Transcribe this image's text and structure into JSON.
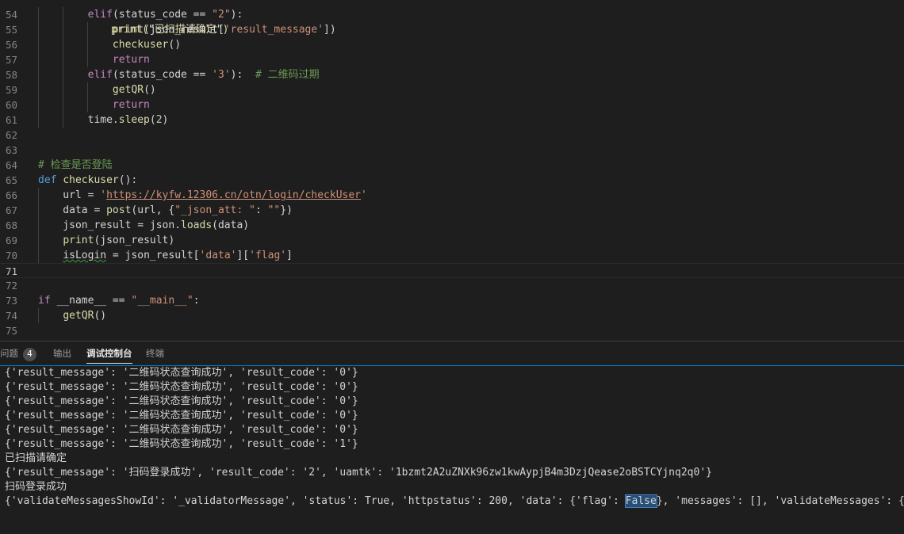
{
  "editor": {
    "lines": [
      {
        "num": "54",
        "segs": [
          {
            "t": "        "
          },
          {
            "t": "elif",
            "c": "kw"
          },
          {
            "t": "(status_code == "
          },
          {
            "t": "\"2\"",
            "c": "str"
          },
          {
            "t": "):"
          }
        ]
      },
      {
        "num": "55",
        "segs": [
          {
            "t": "            "
          },
          {
            "t": "print",
            "c": "fn"
          },
          {
            "t": "(json_result["
          },
          {
            "t": "'result_message'",
            "c": "str"
          },
          {
            "t": "])"
          }
        ]
      },
      {
        "num": "56",
        "segs": [
          {
            "t": "            "
          },
          {
            "t": "checkuser",
            "c": "fn"
          },
          {
            "t": "()"
          }
        ]
      },
      {
        "num": "57",
        "segs": [
          {
            "t": "            "
          },
          {
            "t": "return",
            "c": "kw"
          }
        ]
      },
      {
        "num": "58",
        "segs": [
          {
            "t": "        "
          },
          {
            "t": "elif",
            "c": "kw"
          },
          {
            "t": "(status_code == "
          },
          {
            "t": "'3'",
            "c": "str"
          },
          {
            "t": "):  "
          },
          {
            "t": "# 二维码过期",
            "c": "cm"
          }
        ]
      },
      {
        "num": "59",
        "segs": [
          {
            "t": "            "
          },
          {
            "t": "getQR",
            "c": "fn"
          },
          {
            "t": "()"
          }
        ]
      },
      {
        "num": "60",
        "segs": [
          {
            "t": "            "
          },
          {
            "t": "return",
            "c": "kw"
          }
        ]
      },
      {
        "num": "61",
        "segs": [
          {
            "t": "        time."
          },
          {
            "t": "sleep",
            "c": "fn"
          },
          {
            "t": "("
          },
          {
            "t": "2",
            "c": "num"
          },
          {
            "t": ")"
          }
        ]
      },
      {
        "num": "62",
        "segs": []
      },
      {
        "num": "63",
        "segs": []
      },
      {
        "num": "64",
        "segs": [
          {
            "t": "# 检查是否登陆",
            "c": "cm"
          }
        ]
      },
      {
        "num": "65",
        "segs": [
          {
            "t": "def",
            "c": "def"
          },
          {
            "t": " "
          },
          {
            "t": "checkuser",
            "c": "fn"
          },
          {
            "t": "():"
          }
        ]
      },
      {
        "num": "66",
        "segs": [
          {
            "t": "    url = "
          },
          {
            "t": "'",
            "c": "str"
          },
          {
            "t": "https://kyfw.12306.cn/otn/login/checkUser",
            "c": "url"
          },
          {
            "t": "'",
            "c": "str"
          }
        ]
      },
      {
        "num": "67",
        "segs": [
          {
            "t": "    data = "
          },
          {
            "t": "post",
            "c": "fn"
          },
          {
            "t": "(url, {"
          },
          {
            "t": "\"_json_att: \"",
            "c": "str"
          },
          {
            "t": ": "
          },
          {
            "t": "\"\"",
            "c": "str"
          },
          {
            "t": "})"
          }
        ]
      },
      {
        "num": "68",
        "segs": [
          {
            "t": "    json_result = json."
          },
          {
            "t": "loads",
            "c": "fn"
          },
          {
            "t": "(data)"
          }
        ]
      },
      {
        "num": "69",
        "segs": [
          {
            "t": "    "
          },
          {
            "t": "print",
            "c": "fn"
          },
          {
            "t": "(json_result)"
          }
        ]
      },
      {
        "num": "70",
        "segs": [
          {
            "t": "    "
          },
          {
            "t": "isLogin",
            "c": "squig"
          },
          {
            "t": " = json_result["
          },
          {
            "t": "'data'",
            "c": "str"
          },
          {
            "t": "]["
          },
          {
            "t": "'flag'",
            "c": "str"
          },
          {
            "t": "]"
          }
        ]
      },
      {
        "num": "71",
        "segs": [],
        "current": true
      },
      {
        "num": "72",
        "segs": []
      },
      {
        "num": "73",
        "segs": [
          {
            "t": "if",
            "c": "kw"
          },
          {
            "t": " __name__ == "
          },
          {
            "t": "\"__main__\"",
            "c": "str"
          },
          {
            "t": ":"
          }
        ]
      },
      {
        "num": "74",
        "segs": [
          {
            "t": "    "
          },
          {
            "t": "getQR",
            "c": "fn"
          },
          {
            "t": "()"
          }
        ]
      },
      {
        "num": "75",
        "segs": []
      }
    ],
    "partial_top_text": "print(\"已扫描请确定\")"
  },
  "panel": {
    "tabs": [
      {
        "label": "问题",
        "badge": "4"
      },
      {
        "label": "输出"
      },
      {
        "label": "调试控制台",
        "active": true
      },
      {
        "label": "终端"
      }
    ]
  },
  "console": {
    "lines": [
      "{'result_message': '二维码状态查询成功', 'result_code': '0'}",
      "{'result_message': '二维码状态查询成功', 'result_code': '0'}",
      "{'result_message': '二维码状态查询成功', 'result_code': '0'}",
      "{'result_message': '二维码状态查询成功', 'result_code': '0'}",
      "{'result_message': '二维码状态查询成功', 'result_code': '0'}",
      "{'result_message': '二维码状态查询成功', 'result_code': '1'}",
      "已扫描请确定",
      "{'result_message': '扫码登录成功', 'result_code': '2', 'uamtk': '1bzmt2A2uZNXk96zw1kwAypjB4m3DzjQease2oBSTCYjnq2q0'}",
      "扫码登录成功",
      "{'validateMessagesShowId': '_validatorMessage', 'status': True, 'httpstatus': 200, 'data': {'flag': False}, 'messages': [], 'validateMessages': {}}"
    ],
    "highlight": "False"
  }
}
